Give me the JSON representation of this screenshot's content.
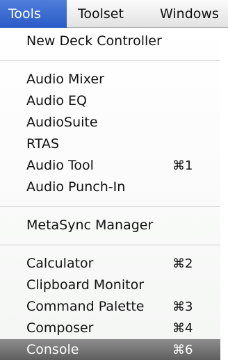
{
  "menubar": {
    "items": [
      {
        "label": "Tools",
        "active": true
      },
      {
        "label": "Toolset"
      },
      {
        "label": "Windows"
      }
    ]
  },
  "menu": {
    "groups": [
      [
        {
          "label": "New Deck Controller",
          "shortcut": ""
        }
      ],
      [
        {
          "label": "Audio Mixer",
          "shortcut": ""
        },
        {
          "label": "Audio EQ",
          "shortcut": ""
        },
        {
          "label": "AudioSuite",
          "shortcut": ""
        },
        {
          "label": "RTAS",
          "shortcut": ""
        },
        {
          "label": "Audio Tool",
          "shortcut": "⌘1"
        },
        {
          "label": "Audio Punch-In",
          "shortcut": ""
        }
      ],
      [
        {
          "label": "MetaSync Manager",
          "shortcut": ""
        }
      ],
      [
        {
          "label": "Calculator",
          "shortcut": "⌘2"
        },
        {
          "label": "Clipboard Monitor",
          "shortcut": ""
        },
        {
          "label": "Command Palette",
          "shortcut": "⌘3"
        },
        {
          "label": "Composer",
          "shortcut": "⌘4"
        },
        {
          "label": "Console",
          "shortcut": "⌘6",
          "selected": true
        }
      ]
    ]
  },
  "colors": {
    "menubar_active": "#3b6fd6",
    "selected_item": "#6b6b6b"
  }
}
